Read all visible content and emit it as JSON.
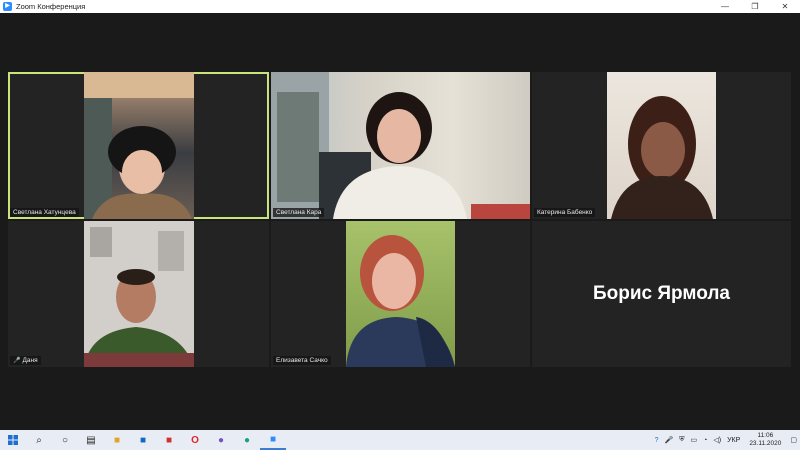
{
  "window": {
    "title": "Zoom Конференция",
    "minimize_glyph": "—",
    "maximize_glyph": "❐",
    "close_glyph": "✕"
  },
  "participants": [
    {
      "name": "Светлана Хатунцева",
      "active_speaker": true,
      "muted": false
    },
    {
      "name": "Светлана Кара",
      "active_speaker": false,
      "muted": false
    },
    {
      "name": "Катерина Бабенко",
      "active_speaker": false,
      "muted": false
    },
    {
      "name": "Даня",
      "active_speaker": false,
      "muted": true
    },
    {
      "name": "Елизавета Сачко",
      "active_speaker": false,
      "muted": false
    },
    {
      "name": "Борис Ярмола",
      "active_speaker": false,
      "video_off": true
    }
  ],
  "taskbar": {
    "icons": [
      "windows-start-icon",
      "search-icon",
      "cortana-icon",
      "task-view-icon",
      "file-explorer-icon",
      "outlook-icon",
      "pdf-icon",
      "opera-icon",
      "viber-icon",
      "edge-icon",
      "zoom-icon"
    ],
    "language": "УКР",
    "time": "11:06",
    "date": "23.11.2020"
  },
  "colors": {
    "active_speaker_border": "#c9e47b",
    "stage_background": "#1a1a1a",
    "tile_background": "#232323"
  }
}
